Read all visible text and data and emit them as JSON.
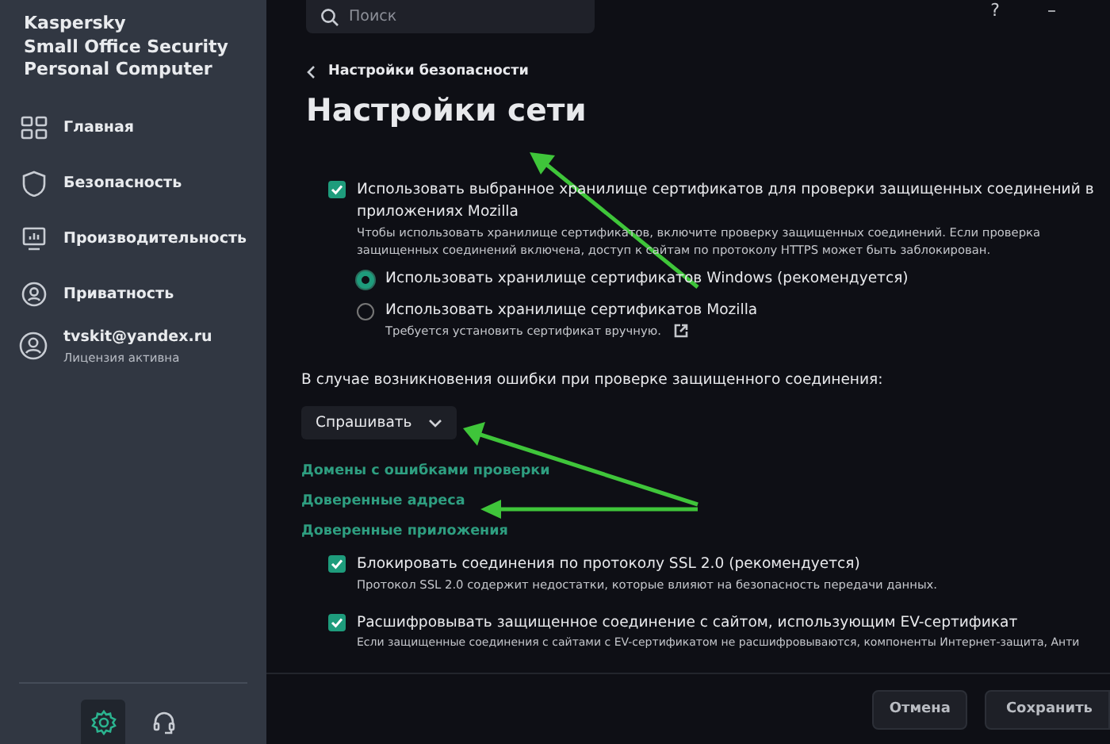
{
  "app_title": [
    "Kaspersky",
    "Small Office Security",
    "Personal Computer"
  ],
  "nav": [
    {
      "label": "Главная"
    },
    {
      "label": "Безопасность"
    },
    {
      "label": "Производительность"
    },
    {
      "label": "Приватность"
    }
  ],
  "account": {
    "email": "tvskit@yandex.ru",
    "license": "Лицензия активна"
  },
  "bottom_icons": [
    {
      "selected": true
    },
    {
      "selected": false
    }
  ],
  "search": {
    "placeholder": "Поиск"
  },
  "window_controls": [
    "?",
    "–"
  ],
  "breadcrumb": "Настройки безопасности",
  "title": "Настройки сети",
  "settings": [
    {
      "kind": "checkbox",
      "label": "Использовать выбранное хранилище сертификатов для проверки защищенных соединений в приложениях Mozilla",
      "hint": "Чтобы использовать хранилище сертификатов, включите проверку защищенных соединений. Если проверка защищенных соединений включена, доступ к сайтам по протоколу HTTPS может быть заблокирован.",
      "checked": true,
      "options": [
        {
          "label": "Использовать хранилище сертификатов Windows (рекомендуется)",
          "selected": true
        },
        {
          "label": "Использовать хранилище сертификатов Mozilla",
          "selected": false,
          "hint": "Требуется установить сертификат вручную.",
          "external_link": true
        }
      ]
    },
    {
      "kind": "label",
      "label": "В случае возникновения ошибки при проверке защищенного соединения:"
    },
    {
      "kind": "dropdown",
      "value": "Спрашивать"
    },
    {
      "kind": "link",
      "label": "Домены с ошибками проверки"
    },
    {
      "kind": "link",
      "label": "Доверенные адреса"
    },
    {
      "kind": "link",
      "label": "Доверенные приложения"
    },
    {
      "kind": "checkbox",
      "label": "Блокировать соединения по протоколу SSL 2.0 (рекомендуется)",
      "hint": "Протокол SSL 2.0 содержит недостатки, которые влияют на безопасность передачи данных.",
      "checked": true
    },
    {
      "kind": "checkbox",
      "label": "Расшифровывать защищенное соединение с сайтом, использующим EV-сертификат",
      "hint": "Если защищенные соединения с сайтами с EV-сертификатом не расшифровываются, компоненты Интернет-защита, Анти",
      "checked": true
    }
  ],
  "footer_buttons": [
    "Отмена",
    "Сохранить"
  ]
}
